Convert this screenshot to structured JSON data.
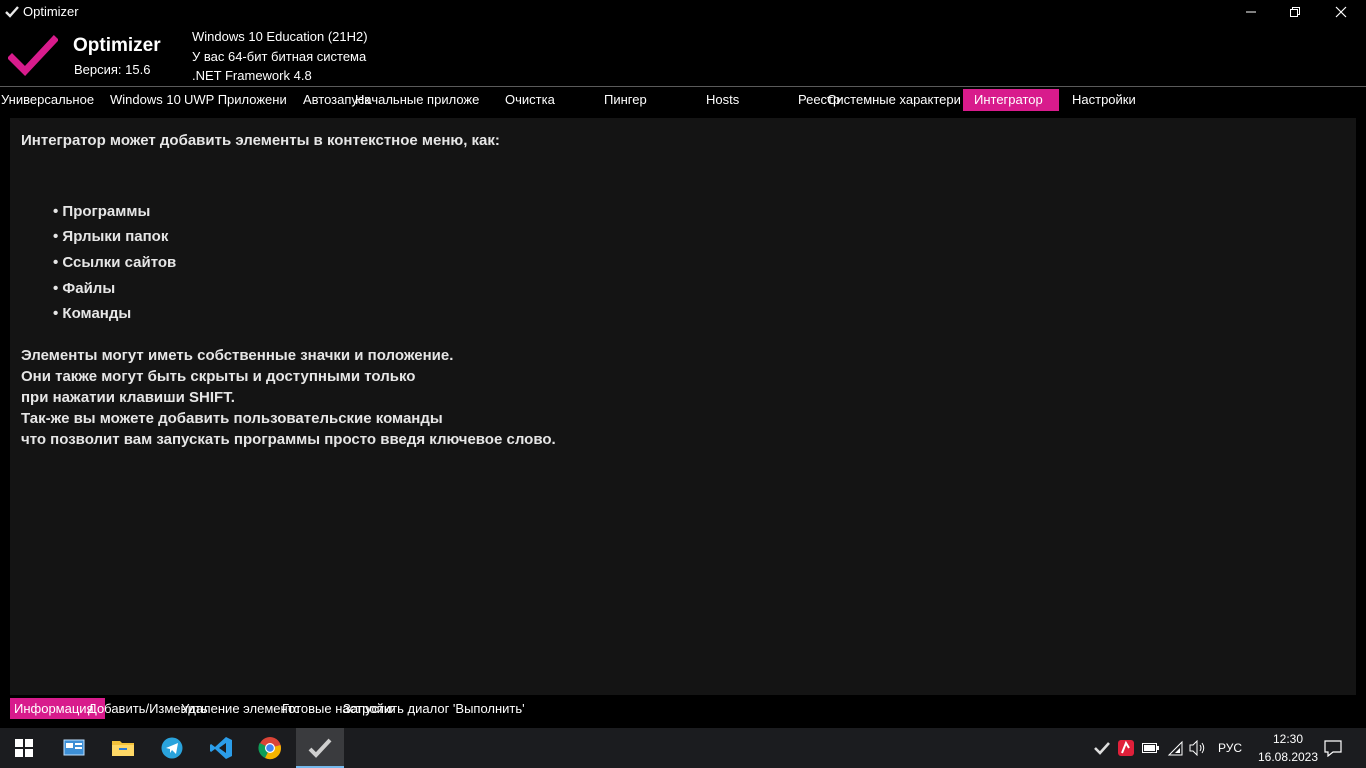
{
  "window": {
    "title": "Optimizer"
  },
  "header": {
    "app_name": "Optimizer",
    "version": "Версия: 15.6",
    "os": "Windows 10 Education (21H2)",
    "arch": "У вас 64-бит битная система",
    "framework": ".NET Framework 4.8"
  },
  "tabs": [
    {
      "label": "Универсальное"
    },
    {
      "label": "Windows 10"
    },
    {
      "label": "UWP Приложени"
    },
    {
      "label": "Автозапуск"
    },
    {
      "label": "Начальные приложе"
    },
    {
      "label": "Очистка"
    },
    {
      "label": "Пингер"
    },
    {
      "label": "Hosts"
    },
    {
      "label": "Реестр"
    },
    {
      "label": "Системные характери"
    },
    {
      "label": "Интегратор"
    },
    {
      "label": "Настройки"
    }
  ],
  "active_tab": "Интегратор",
  "content": {
    "heading": "Интегратор может добавить элементы в контекстное меню, как:",
    "bullets": [
      "• Программы",
      "• Ярлыки папок",
      "• Ссылки сайтов",
      "• Файлы",
      "• Команды"
    ],
    "paragraph": [
      "Элементы могут иметь собственные значки и положение.",
      "Они также могут быть скрыты и доступными только",
      "при нажатии клавиши SHIFT.",
      "Так-же вы можете добавить пользовательские команды",
      "что позволит вам запускать программы просто введя ключевое слово."
    ]
  },
  "subtabs": [
    {
      "label": "Информация"
    },
    {
      "label": "Добавить/Изменить"
    },
    {
      "label": "Удаление элементов"
    },
    {
      "label": "Готовые настройки"
    },
    {
      "label": "Запустить диалог 'Выполнить'"
    }
  ],
  "active_subtab": "Информация",
  "taskbar": {
    "apps": [
      "start-icon",
      "control-panel-icon",
      "file-explorer-icon",
      "telegram-icon",
      "vscode-icon",
      "chrome-icon",
      "optimizer-icon"
    ],
    "tray": [
      "optimizer-tray-icon",
      "antivirus-icon",
      "battery-icon",
      "wifi-icon",
      "volume-icon"
    ],
    "language": "РУС",
    "time": "12:30",
    "date": "16.08.2023"
  },
  "colors": {
    "accent": "#d81b8c",
    "background": "#000000",
    "panel": "#141414",
    "taskbar": "#1b1c1f"
  }
}
